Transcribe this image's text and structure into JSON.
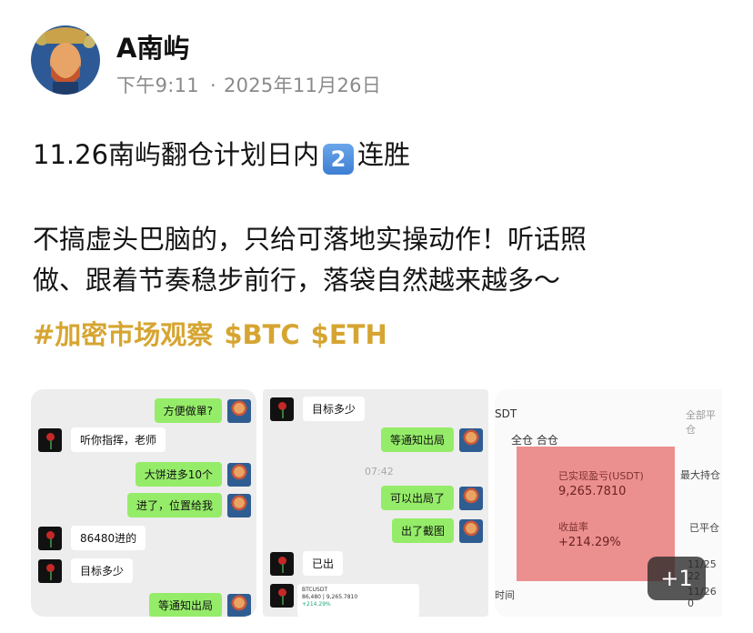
{
  "post": {
    "author": "A南屿",
    "time": "下午9:11",
    "date": "2025年11月26日",
    "title_before": "11.26南屿翻仓计划日内",
    "title_badge": "2",
    "title_after": "连胜",
    "body_line1": "不搞虚头巴脑的，只给可落地实操动作！听话照",
    "body_line2": "做、跟着节奏稳步前行，落袋自然越来越多～",
    "tags": [
      "#加密市场观察",
      "$BTC",
      "$ETH"
    ]
  },
  "thumb1": {
    "messages": [
      {
        "side": "me",
        "text": "方便做單?"
      },
      {
        "side": "them",
        "text": "听你指挥，老师"
      },
      {
        "side": "me",
        "text": "大饼进多10个"
      },
      {
        "side": "me",
        "text": "进了，位置给我"
      },
      {
        "side": "them",
        "text": "86480进的"
      },
      {
        "side": "them",
        "text": "目标多少"
      },
      {
        "side": "me",
        "text": "等通知出局"
      }
    ]
  },
  "thumb2": {
    "messages": [
      {
        "side": "them",
        "text": "目标多少"
      },
      {
        "side": "me",
        "text": "等通知出局"
      },
      {
        "side": "me",
        "text": "可以出局了"
      },
      {
        "side": "me",
        "text": "出了截图"
      },
      {
        "side": "them",
        "text": "已出"
      }
    ],
    "time": "07:42",
    "mini_title": "BTCUSDT",
    "mini_row1": "86,480  |  9,265.7810",
    "mini_row2": "+214.29%"
  },
  "thumb3": {
    "head_left": "SDT",
    "head_right": "全部平仓",
    "tab1": "全仓",
    "tab2": "合仓",
    "pnl_label": "已实现盈亏(USDT)",
    "pnl_value": "9,265.7810",
    "roi_label": "收益率",
    "roi_value": "+214.29%",
    "side_label1": "最大持仓",
    "side_label2": "已平仓",
    "date1": "11/25 22",
    "date2": "11/26 0",
    "bottom_label": "时间"
  },
  "more_count": "+1"
}
